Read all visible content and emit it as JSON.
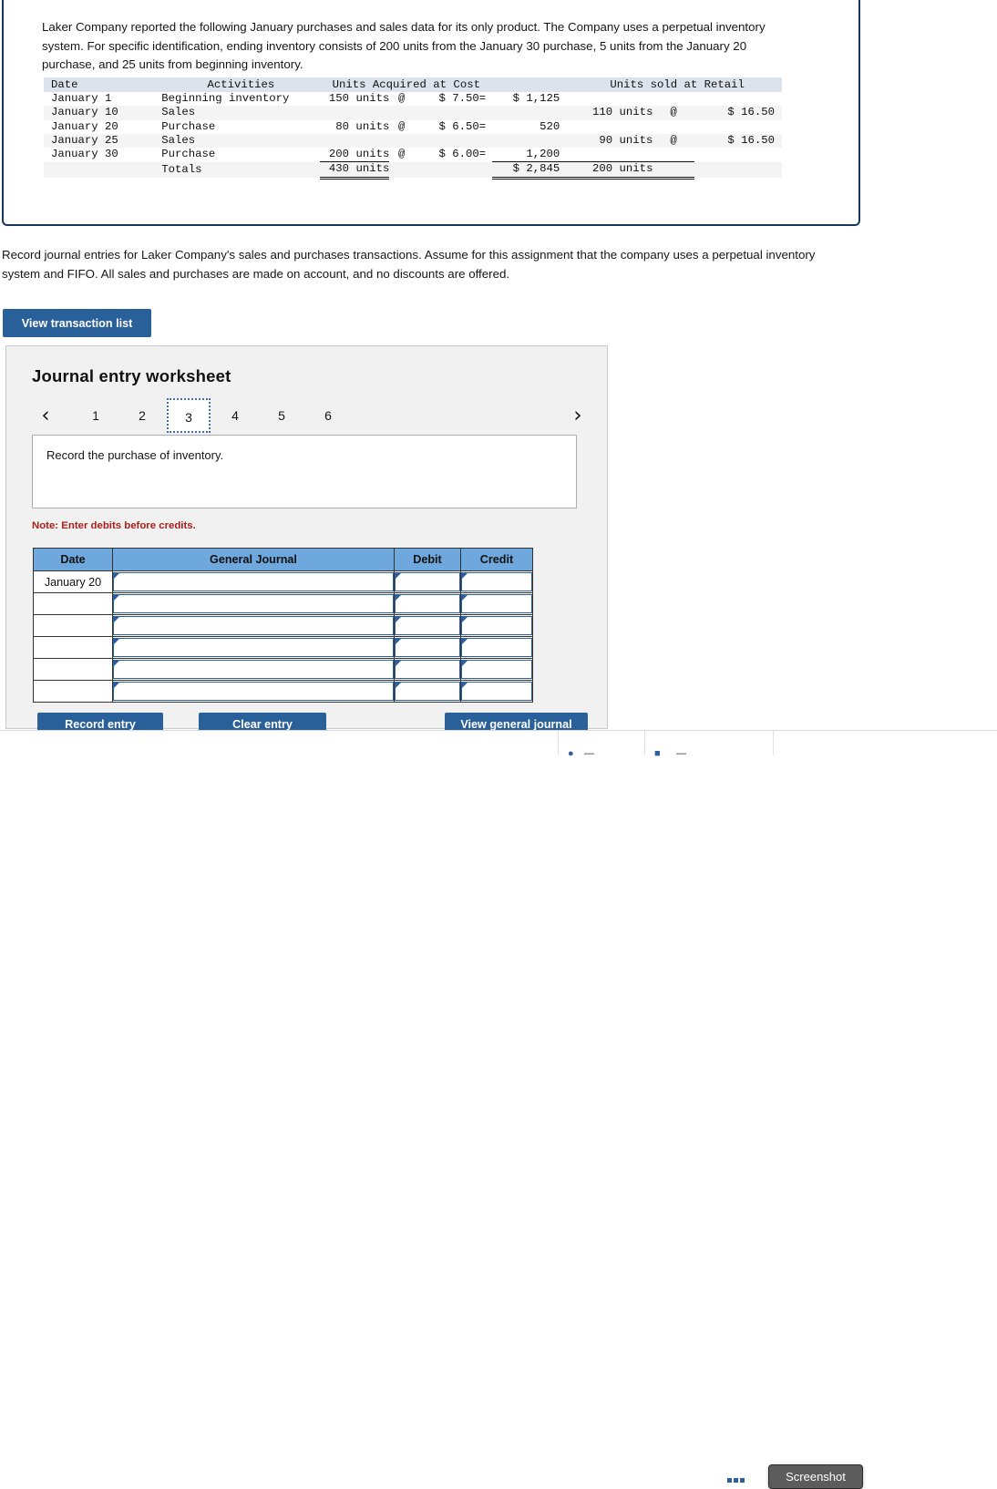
{
  "problem": {
    "intro": "Laker Company reported the following January purchases and sales data for its only product. The Company uses a perpetual inventory system. For specific identification, ending inventory consists of 200 units from the January 30 purchase, 5 units from the January 20 purchase, and 25 units from beginning inventory."
  },
  "data_table": {
    "headers": {
      "date": "Date",
      "activities": "Activities",
      "acquired": "Units Acquired at Cost",
      "sold": "Units sold at Retail"
    },
    "rows": [
      {
        "date": "January 1",
        "activity": "Beginning inventory",
        "units_acquired": "150 units",
        "at": "@",
        "unit_cost": "$ 7.50",
        "eq": "=",
        "total_cost": "$ 1,125",
        "units_sold": "",
        "at2": "",
        "retail": ""
      },
      {
        "date": "January 10",
        "activity": "Sales",
        "units_acquired": "",
        "at": "",
        "unit_cost": "",
        "eq": "",
        "total_cost": "",
        "units_sold": "110 units",
        "at2": "@",
        "retail": "$ 16.50"
      },
      {
        "date": "January 20",
        "activity": "Purchase",
        "units_acquired": "80 units",
        "at": "@",
        "unit_cost": "$ 6.50",
        "eq": "=",
        "total_cost": "520",
        "units_sold": "",
        "at2": "",
        "retail": ""
      },
      {
        "date": "January 25",
        "activity": "Sales",
        "units_acquired": "",
        "at": "",
        "unit_cost": "",
        "eq": "",
        "total_cost": "",
        "units_sold": "90 units",
        "at2": "@",
        "retail": "$ 16.50"
      },
      {
        "date": "January 30",
        "activity": "Purchase",
        "units_acquired": "200 units",
        "at": "@",
        "unit_cost": "$ 6.00",
        "eq": "=",
        "total_cost": "1,200",
        "units_sold": "",
        "at2": "",
        "retail": ""
      }
    ],
    "totals": {
      "label": "Totals",
      "units_acquired": "430 units",
      "total_cost": "$ 2,845",
      "units_sold": "200 units"
    }
  },
  "requirement": {
    "text": "Record journal entries for Laker Company's sales and purchases transactions. Assume for this assignment that the company uses a perpetual inventory system and FIFO. All sales and purchases are made on account, and no discounts are offered."
  },
  "buttons": {
    "view_transaction_list": "View transaction list",
    "record_entry": "Record entry",
    "clear_entry": "Clear entry",
    "view_general_journal": "View general journal"
  },
  "worksheet": {
    "title": "Journal entry worksheet",
    "prev_chevron": "‹",
    "next_chevron": "›",
    "tabs": [
      {
        "label": "1",
        "active": false
      },
      {
        "label": "2",
        "active": false
      },
      {
        "label": "3",
        "active": true
      },
      {
        "label": "4",
        "active": false
      },
      {
        "label": "5",
        "active": false
      },
      {
        "label": "6",
        "active": false
      }
    ],
    "instruction": "Record the purchase of inventory.",
    "note": "Note: Enter debits before credits.",
    "journal_headers": {
      "date": "Date",
      "general_journal": "General Journal",
      "debit": "Debit",
      "credit": "Credit"
    },
    "journal_rows": [
      {
        "date": "January 20",
        "account": "",
        "debit": "",
        "credit": ""
      },
      {
        "date": "",
        "account": "",
        "debit": "",
        "credit": ""
      },
      {
        "date": "",
        "account": "",
        "debit": "",
        "credit": ""
      },
      {
        "date": "",
        "account": "",
        "debit": "",
        "credit": ""
      },
      {
        "date": "",
        "account": "",
        "debit": "",
        "credit": ""
      },
      {
        "date": "",
        "account": "",
        "debit": "",
        "credit": ""
      }
    ]
  },
  "taskbar": {
    "tooltip": "Screenshot"
  },
  "colors": {
    "accent_blue": "#2a6099",
    "table_header_blue": "#6fa8dc",
    "note_red": "#a8201a",
    "panel_border": "#17365d"
  }
}
